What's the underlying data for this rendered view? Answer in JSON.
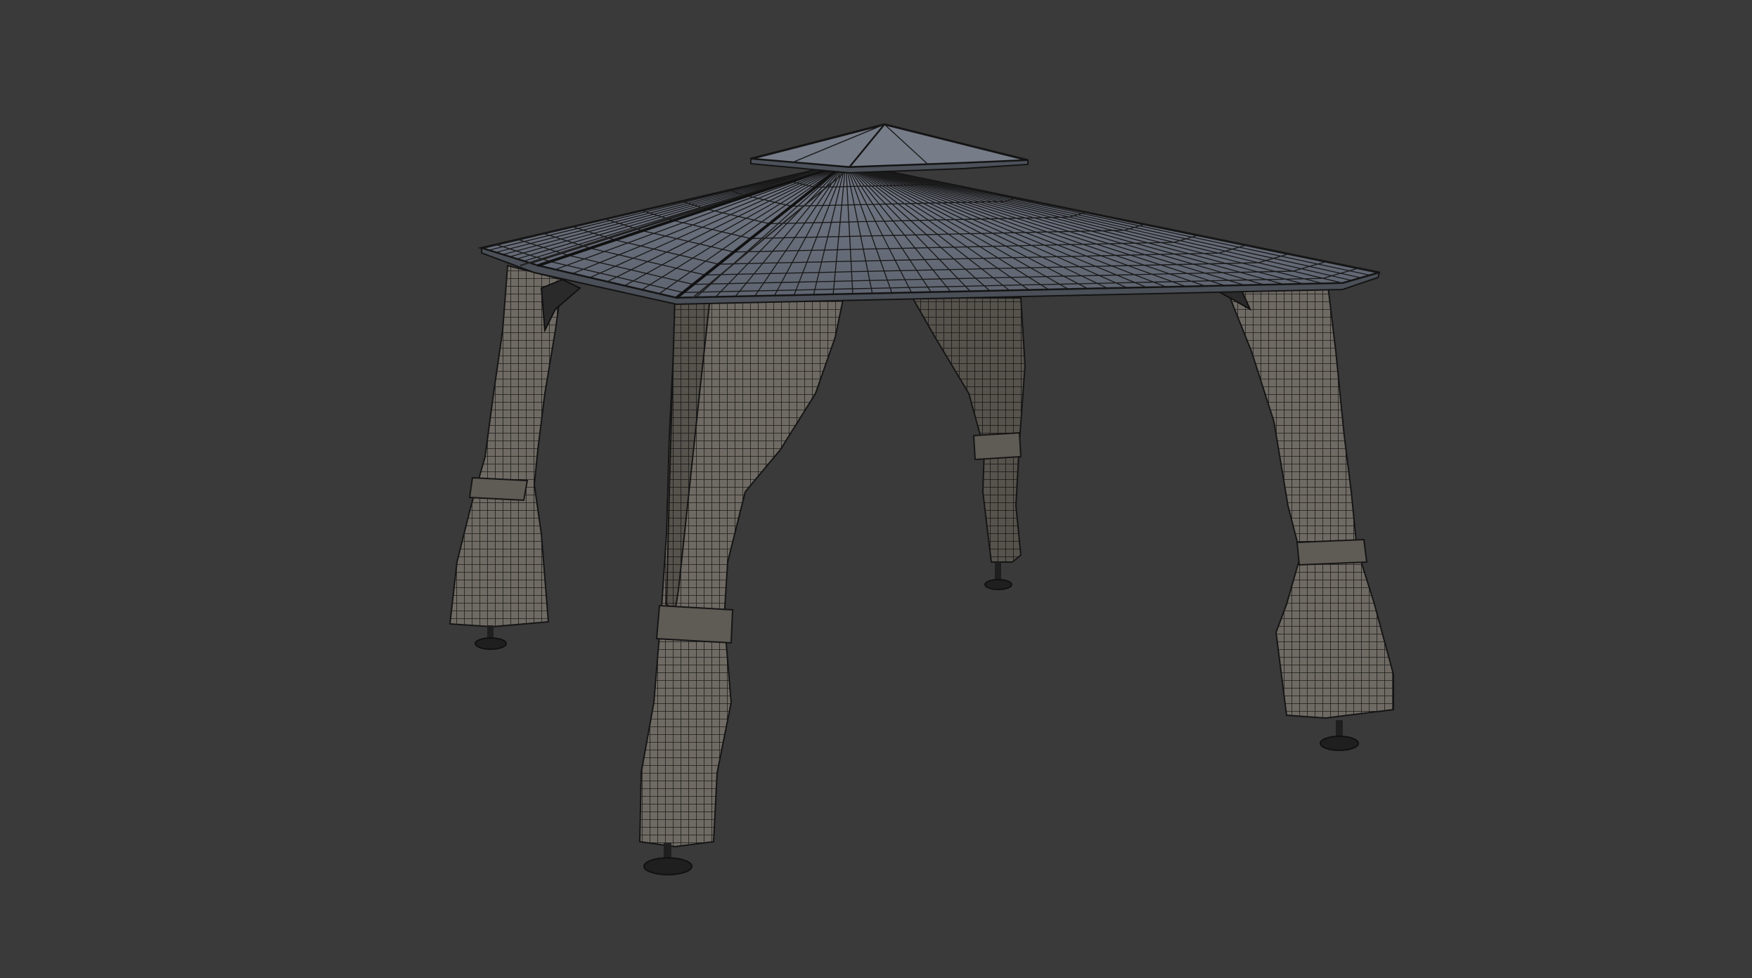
{
  "viewport": {
    "background": "#3a3a3a",
    "mode": "wireframe-over-solid"
  },
  "model": {
    "object": "gazebo",
    "roof_color": "#6c727e",
    "roof_dark_color": "#565b66",
    "curtain_color": "#6f6a63",
    "curtain_shadow_color": "#56524c",
    "wire_color": "#1a1a1a",
    "foot_color": "#1f1f1f",
    "tie_color": "#5f5b55"
  }
}
